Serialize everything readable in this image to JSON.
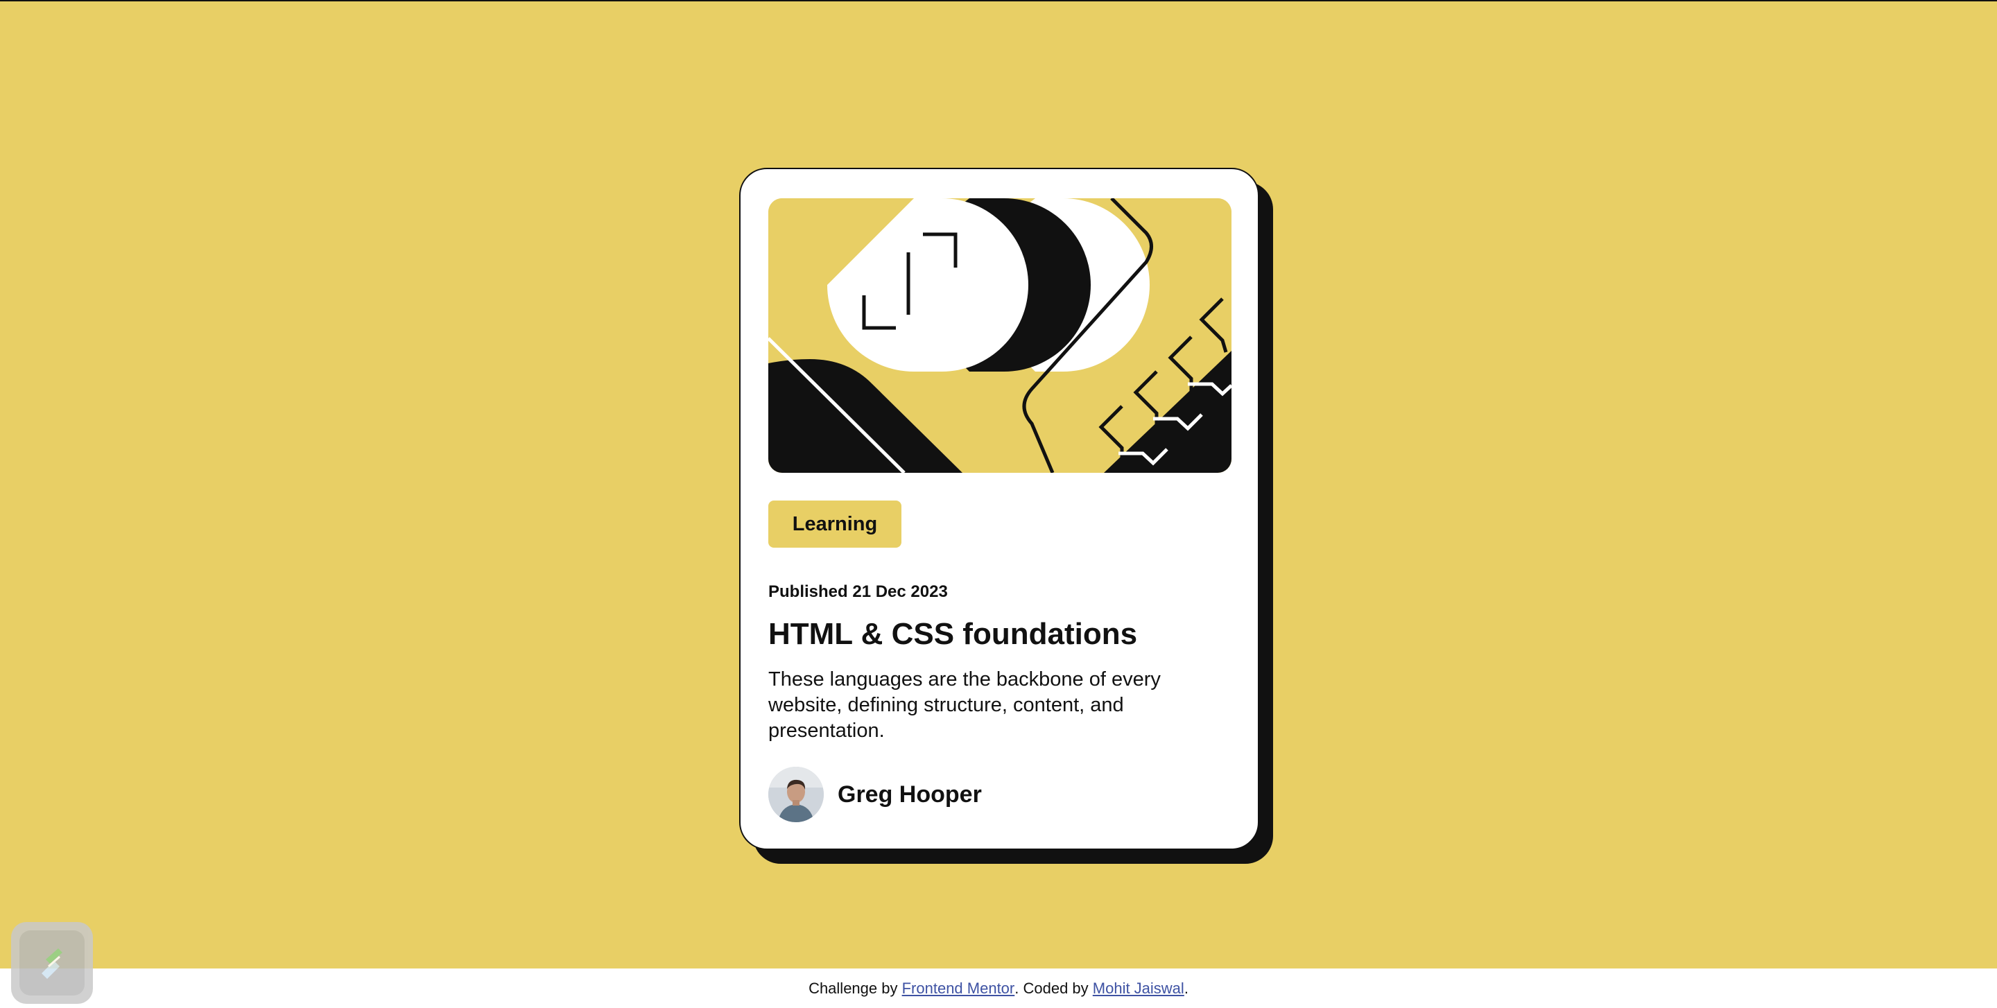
{
  "card": {
    "tag": "Learning",
    "published": "Published 21 Dec 2023",
    "title": "HTML & CSS foundations",
    "description": "These languages are the backbone of every website, defining structure, content, and presentation.",
    "author": "Greg Hooper"
  },
  "footer": {
    "prefix": "Challenge by ",
    "challenge_link": "Frontend Mentor",
    "middle": ". Coded by ",
    "coder_link": "Mohit Jaiswal",
    "suffix": "."
  },
  "colors": {
    "background": "#e8cf65",
    "card": "#ffffff",
    "ink": "#111111",
    "link": "#3e52a3"
  },
  "icons": {
    "hero": "abstract-illustration",
    "avatar": "avatar-photo",
    "badge": "screen-tool-icon"
  }
}
